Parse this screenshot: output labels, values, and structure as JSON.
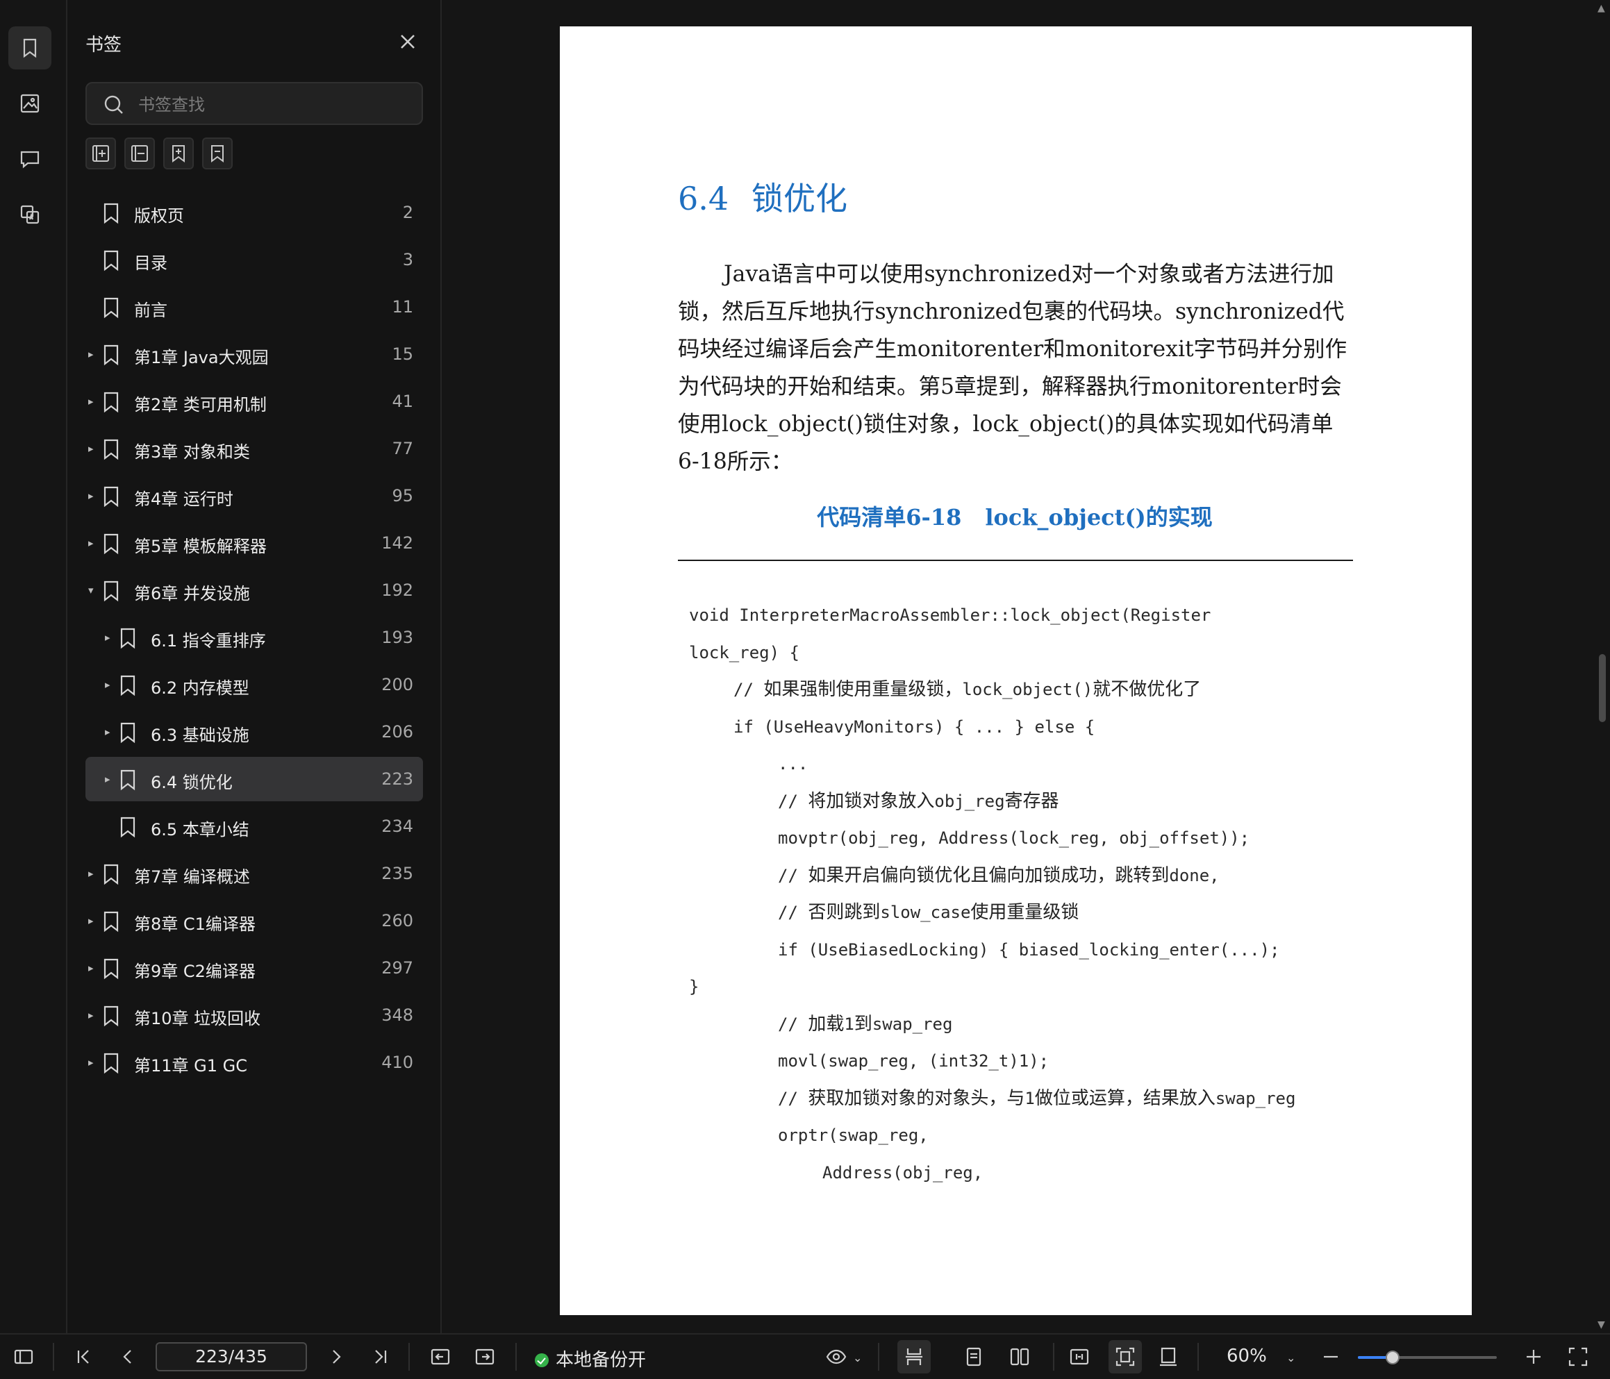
{
  "rail": {
    "items": [
      {
        "name": "bookmark-icon"
      },
      {
        "name": "image-icon"
      },
      {
        "name": "comment-icon"
      },
      {
        "name": "translate-icon"
      }
    ]
  },
  "sidebar": {
    "title": "书签",
    "search_placeholder": "书签查找",
    "tools": [
      "add-bookmark-icon",
      "collapse-bookmark-icon",
      "add-child-bookmark-icon",
      "remove-bookmark-icon"
    ],
    "bookmarks": [
      {
        "label": "版权页",
        "page": "2",
        "level": 0,
        "expander": "",
        "selected": false
      },
      {
        "label": "目录",
        "page": "3",
        "level": 0,
        "expander": "",
        "selected": false
      },
      {
        "label": "前言",
        "page": "11",
        "level": 0,
        "expander": "",
        "selected": false
      },
      {
        "label": "第1章 Java大观园",
        "page": "15",
        "level": 0,
        "expander": "▸",
        "selected": false
      },
      {
        "label": "第2章 类可用机制",
        "page": "41",
        "level": 0,
        "expander": "▸",
        "selected": false
      },
      {
        "label": "第3章 对象和类",
        "page": "77",
        "level": 0,
        "expander": "▸",
        "selected": false
      },
      {
        "label": "第4章 运行时",
        "page": "95",
        "level": 0,
        "expander": "▸",
        "selected": false
      },
      {
        "label": "第5章 模板解释器",
        "page": "142",
        "level": 0,
        "expander": "▸",
        "selected": false
      },
      {
        "label": "第6章 并发设施",
        "page": "192",
        "level": 0,
        "expander": "▾",
        "selected": false
      },
      {
        "label": "6.1 指令重排序",
        "page": "193",
        "level": 1,
        "expander": "▸",
        "selected": false
      },
      {
        "label": "6.2 内存模型",
        "page": "200",
        "level": 1,
        "expander": "▸",
        "selected": false
      },
      {
        "label": "6.3 基础设施",
        "page": "206",
        "level": 1,
        "expander": "▸",
        "selected": false
      },
      {
        "label": "6.4 锁优化",
        "page": "223",
        "level": 1,
        "expander": "▸",
        "selected": true
      },
      {
        "label": "6.5 本章小结",
        "page": "234",
        "level": 1,
        "expander": "",
        "selected": false
      },
      {
        "label": "第7章 编译概述",
        "page": "235",
        "level": 0,
        "expander": "▸",
        "selected": false
      },
      {
        "label": "第8章 C1编译器",
        "page": "260",
        "level": 0,
        "expander": "▸",
        "selected": false
      },
      {
        "label": "第9章 C2编译器",
        "page": "297",
        "level": 0,
        "expander": "▸",
        "selected": false
      },
      {
        "label": "第10章 垃圾回收",
        "page": "348",
        "level": 0,
        "expander": "▸",
        "selected": false
      },
      {
        "label": "第11章 G1 GC",
        "page": "410",
        "level": 0,
        "expander": "▸",
        "selected": false
      }
    ]
  },
  "document": {
    "section_number": "6.4",
    "section_title": "锁优化",
    "paragraph": "Java语言中可以使用synchronized对一个对象或者方法进行加锁，然后互斥地执行synchronized包裹的代码块。synchronized代码块经过编译后会产生monitorenter和monitorexit字节码并分别作为代码块的开始和结束。第5章提到，解释器执行monitorenter时会使用lock_object()锁住对象，lock_object()的具体实现如代码清单6-18所示：",
    "listing_number": "代码清单6-18",
    "listing_title": "lock_object()的实现",
    "code_lines": [
      {
        "indent": 0,
        "parts": [
          {
            "t": "void InterpreterMacroAssembler::lock_object(Register",
            "c": false
          }
        ]
      },
      {
        "indent": 0,
        "parts": [
          {
            "t": "lock_reg) {",
            "c": false
          }
        ]
      },
      {
        "indent": 1,
        "parts": [
          {
            "t": "// ",
            "c": false
          },
          {
            "t": "如果强制使用重量级锁，",
            "c": true
          },
          {
            "t": "lock_object()",
            "c": false
          },
          {
            "t": "就不做优化了",
            "c": true
          }
        ]
      },
      {
        "indent": 1,
        "parts": [
          {
            "t": "if (UseHeavyMonitors) { ... } else {",
            "c": false
          }
        ]
      },
      {
        "indent": 2,
        "parts": [
          {
            "t": "...",
            "c": false
          }
        ]
      },
      {
        "indent": 2,
        "parts": [
          {
            "t": "// ",
            "c": false
          },
          {
            "t": "将加锁对象放入",
            "c": true
          },
          {
            "t": "obj_reg",
            "c": false
          },
          {
            "t": "寄存器",
            "c": true
          }
        ]
      },
      {
        "indent": 2,
        "parts": [
          {
            "t": "movptr(obj_reg, Address(lock_reg, obj_offset));",
            "c": false
          }
        ]
      },
      {
        "indent": 2,
        "parts": [
          {
            "t": "// ",
            "c": false
          },
          {
            "t": "如果开启偏向锁优化且偏向加锁成功，跳转到",
            "c": true
          },
          {
            "t": "done,",
            "c": false
          }
        ]
      },
      {
        "indent": 2,
        "parts": [
          {
            "t": "// ",
            "c": false
          },
          {
            "t": "否则跳到",
            "c": true
          },
          {
            "t": "slow_case",
            "c": false
          },
          {
            "t": "使用重量级锁",
            "c": true
          }
        ]
      },
      {
        "indent": 2,
        "parts": [
          {
            "t": "if (UseBiasedLocking) { biased_locking_enter(...);",
            "c": false
          }
        ]
      },
      {
        "indent": 0,
        "parts": [
          {
            "t": "}",
            "c": false
          }
        ]
      },
      {
        "indent": 2,
        "parts": [
          {
            "t": "// ",
            "c": false
          },
          {
            "t": "加载",
            "c": true
          },
          {
            "t": "1",
            "c": false
          },
          {
            "t": "到",
            "c": true
          },
          {
            "t": "swap_reg",
            "c": false
          }
        ]
      },
      {
        "indent": 2,
        "parts": [
          {
            "t": "movl(swap_reg, (int32_t)1);",
            "c": false
          }
        ]
      },
      {
        "indent": 2,
        "parts": [
          {
            "t": "// ",
            "c": false
          },
          {
            "t": "获取加锁对象的对象头，与",
            "c": true
          },
          {
            "t": "1",
            "c": false
          },
          {
            "t": "做位或运算，结果放入",
            "c": true
          },
          {
            "t": "swap_reg",
            "c": false
          }
        ]
      },
      {
        "indent": 2,
        "parts": [
          {
            "t": "orptr(swap_reg,",
            "c": false
          }
        ]
      },
      {
        "indent": 3,
        "parts": [
          {
            "t": "Address(obj_reg,",
            "c": false
          }
        ]
      }
    ]
  },
  "bottombar": {
    "page_value": "223/435",
    "backup_status": "本地备份开",
    "zoom": "60%",
    "zoom_fraction": 0.25
  },
  "colors": {
    "accent": "#1f6fbf",
    "background": "#151515",
    "selected_row": "#343436",
    "status_green": "#35b24a",
    "slider_blue": "#3b82f6"
  }
}
